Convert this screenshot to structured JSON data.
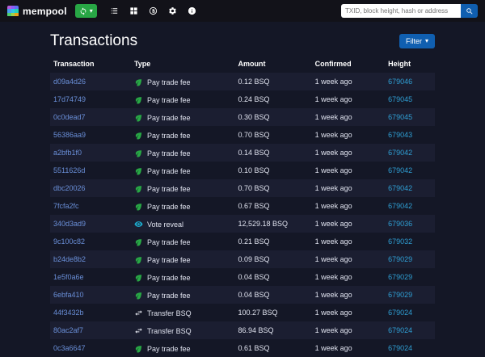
{
  "navbar": {
    "brand": "mempool",
    "logo_colors": [
      "#b55ddb",
      "#8d5cf6",
      "#5e6ff0",
      "#4a9ff0",
      "#30c3e8",
      "#25d0b4",
      "#51d06e",
      "#9fd04a",
      "#e8a21f"
    ],
    "refresh_icon": "sync-icon",
    "nav_icons": [
      "list-icon",
      "blocks-icon",
      "bisq-icon",
      "gears-icon",
      "info-icon"
    ],
    "search": {
      "placeholder": "TXID, block height, hash or address"
    }
  },
  "page": {
    "title": "Transactions",
    "filter_label": "Filter"
  },
  "table": {
    "headers": [
      "Transaction",
      "Type",
      "Amount",
      "Confirmed",
      "Height"
    ],
    "rows": [
      {
        "txid": "d09a4d26",
        "icon": "leaf-icon",
        "type": "Pay trade fee",
        "amount": "0.12 BSQ",
        "confirmed": "1 week ago",
        "height": "679046"
      },
      {
        "txid": "17d74749",
        "icon": "leaf-icon",
        "type": "Pay trade fee",
        "amount": "0.24 BSQ",
        "confirmed": "1 week ago",
        "height": "679045"
      },
      {
        "txid": "0c0dead7",
        "icon": "leaf-icon",
        "type": "Pay trade fee",
        "amount": "0.30 BSQ",
        "confirmed": "1 week ago",
        "height": "679045"
      },
      {
        "txid": "56386aa9",
        "icon": "leaf-icon",
        "type": "Pay trade fee",
        "amount": "0.70 BSQ",
        "confirmed": "1 week ago",
        "height": "679043"
      },
      {
        "txid": "a2bfb1f0",
        "icon": "leaf-icon",
        "type": "Pay trade fee",
        "amount": "0.14 BSQ",
        "confirmed": "1 week ago",
        "height": "679042"
      },
      {
        "txid": "5511626d",
        "icon": "leaf-icon",
        "type": "Pay trade fee",
        "amount": "0.10 BSQ",
        "confirmed": "1 week ago",
        "height": "679042"
      },
      {
        "txid": "dbc20026",
        "icon": "leaf-icon",
        "type": "Pay trade fee",
        "amount": "0.70 BSQ",
        "confirmed": "1 week ago",
        "height": "679042"
      },
      {
        "txid": "7fcfa2fc",
        "icon": "leaf-icon",
        "type": "Pay trade fee",
        "amount": "0.67 BSQ",
        "confirmed": "1 week ago",
        "height": "679042"
      },
      {
        "txid": "340d3ad9",
        "icon": "eye-icon",
        "type": "Vote reveal",
        "amount": "12,529.18 BSQ",
        "confirmed": "1 week ago",
        "height": "679036"
      },
      {
        "txid": "9c100c82",
        "icon": "leaf-icon",
        "type": "Pay trade fee",
        "amount": "0.21 BSQ",
        "confirmed": "1 week ago",
        "height": "679032"
      },
      {
        "txid": "b24de8b2",
        "icon": "leaf-icon",
        "type": "Pay trade fee",
        "amount": "0.09 BSQ",
        "confirmed": "1 week ago",
        "height": "679029"
      },
      {
        "txid": "1e5f0a6e",
        "icon": "leaf-icon",
        "type": "Pay trade fee",
        "amount": "0.04 BSQ",
        "confirmed": "1 week ago",
        "height": "679029"
      },
      {
        "txid": "6ebfa410",
        "icon": "leaf-icon",
        "type": "Pay trade fee",
        "amount": "0.04 BSQ",
        "confirmed": "1 week ago",
        "height": "679029"
      },
      {
        "txid": "44f3432b",
        "icon": "transfer-icon",
        "type": "Transfer BSQ",
        "amount": "100.27 BSQ",
        "confirmed": "1 week ago",
        "height": "679024"
      },
      {
        "txid": "80ac2af7",
        "icon": "transfer-icon",
        "type": "Transfer BSQ",
        "amount": "86.94 BSQ",
        "confirmed": "1 week ago",
        "height": "679024"
      },
      {
        "txid": "0c3a6647",
        "icon": "leaf-icon",
        "type": "Pay trade fee",
        "amount": "0.61 BSQ",
        "confirmed": "1 week ago",
        "height": "679024"
      }
    ]
  },
  "colors": {
    "accent_green": "#28a745",
    "accent_blue": "#105fb0",
    "txid_link": "#6a8fd8",
    "height_link": "#2f9fd4",
    "leaf_green": "#28a745",
    "eye_teal": "#1ca8c9",
    "transfer_white": "#e8eaf2"
  }
}
